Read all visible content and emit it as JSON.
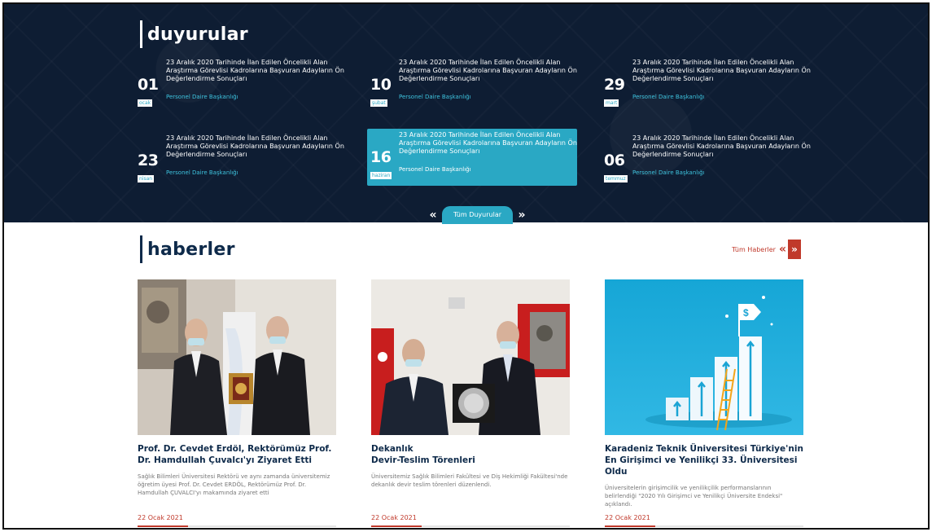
{
  "announcements": {
    "title": "duyurular",
    "items": [
      {
        "day": "01",
        "month": "ocak",
        "text": "23 Aralık 2020 Tarihinde İlan Edilen Öncelikli Alan Araştırma Görevlisi Kadrolarına Başvuran Adayların Ön Değerlendirme Sonuçları",
        "source": "Personel Daire Başkanlığı"
      },
      {
        "day": "10",
        "month": "şubat",
        "text": "23 Aralık 2020 Tarihinde İlan Edilen Öncelikli Alan Araştırma Görevlisi Kadrolarına Başvuran Adayların Ön Değerlendirme Sonuçları",
        "source": "Personel Daire Başkanlığı"
      },
      {
        "day": "29",
        "month": "mart",
        "text": "23 Aralık 2020 Tarihinde İlan Edilen Öncelikli Alan Araştırma Görevlisi Kadrolarına Başvuran Adayların Ön Değerlendirme Sonuçları",
        "source": "Personel Daire Başkanlığı"
      },
      {
        "day": "23",
        "month": "nisan",
        "text": "23 Aralık 2020 Tarihinde İlan Edilen Öncelikli Alan Araştırma Görevlisi Kadrolarına Başvuran Adayların Ön Değerlendirme Sonuçları",
        "source": "Personel Daire Başkanlığı"
      },
      {
        "day": "16",
        "month": "haziran",
        "text": "23 Aralık 2020 Tarihinde İlan Edilen Öncelikli Alan Araştırma Görevlisi Kadrolarına Başvuran Adayların Ön Değerlendirme Sonuçları",
        "source": "Personel Daire Başkanlığı"
      },
      {
        "day": "06",
        "month": "temmuz",
        "text": "23 Aralık 2020 Tarihinde İlan Edilen Öncelikli Alan Araştırma Görevlisi Kadrolarına Başvuran Adayların Ön Değerlendirme Sonuçları",
        "source": "Personel Daire Başkanlığı"
      }
    ],
    "all_label": "Tüm Duyurular",
    "prev_glyph": "«",
    "next_glyph": "»"
  },
  "news": {
    "title": "haberler",
    "all_label": "Tüm Haberler",
    "prev_glyph": "«",
    "next_glyph": "»",
    "items": [
      {
        "headline": "Prof. Dr. Cevdet Erdöl, Rektörümüz Prof. Dr. Hamdullah Çuvalcı'yı Ziyaret Etti",
        "body": "Sağlık Bilimleri Üniversitesi Rektörü ve aynı zamanda üniversitemiz öğretim üyesi Prof. Dr. Cevdet ERDÖL, Rektörümüz Prof. Dr. Hamdullah ÇUVALCI'yı makamında ziyaret etti",
        "date": "22 Ocak 2021"
      },
      {
        "headline": "Dekanlık\nDevir-Teslim Törenleri",
        "body": "Üniversitemiz Sağlık Bilimleri Fakültesi ve Diş Hekimliği Fakültesi'nde dekanlık devir teslim törenleri düzenlendi.",
        "date": "22 Ocak 2021"
      },
      {
        "headline": "Karadeniz Teknik Üniversitesi Türkiye'nin En Girişimci ve Yenilikçi 33. Üniversitesi Oldu",
        "body": "Üniversitelerin girişimcilik ve yenilikçilik performanslarının belirlendiği \"2020 Yılı Girişimci ve Yenilikçi Üniversite Endeksi\" açıklandı.",
        "date": "22 Ocak 2021"
      }
    ]
  },
  "colors": {
    "dark_bg": "#0e1d33",
    "accent": "#2aa8c4",
    "news_accent": "#c0392b",
    "title_dark": "#0e2a4a"
  }
}
